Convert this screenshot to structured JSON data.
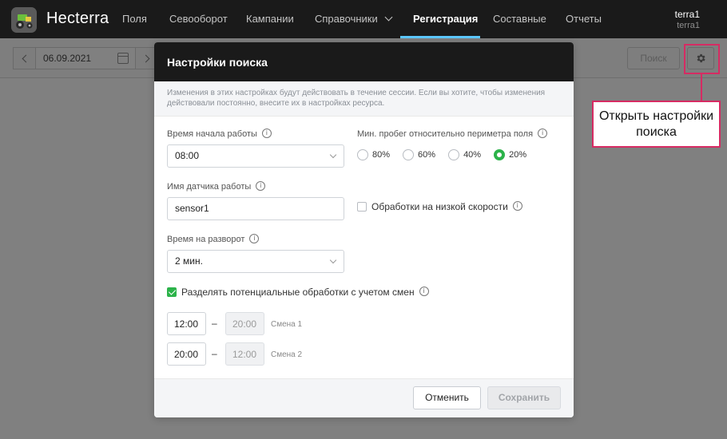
{
  "app": {
    "brand": "Hecterra",
    "logo_icon": "tractor-icon"
  },
  "nav": {
    "items": [
      {
        "label": "Поля"
      },
      {
        "label": "Севооборот"
      },
      {
        "label": "Кампании"
      },
      {
        "label": "Справочники"
      },
      {
        "label": "Регистрация"
      },
      {
        "label": "Составные"
      },
      {
        "label": "Отчеты"
      }
    ],
    "active": "Регистрация",
    "active_color": "#5cc8ff"
  },
  "user": {
    "name": "terra1",
    "account": "terra1"
  },
  "toolbar": {
    "date": "06.09.2021",
    "search_label": "Поиск"
  },
  "annotation": {
    "text": "Открыть настройки поиска",
    "color": "#d62b63"
  },
  "modal": {
    "title": "Настройки поиска",
    "note": "Изменения в этих настройках будут действовать в течение сессии. Если вы хотите, чтобы изменения действовали постоянно, внесите их в настройках ресурса.",
    "start_time": {
      "label": "Время начала работы",
      "value": "08:00"
    },
    "sensor": {
      "label": "Имя датчика работы",
      "value": "sensor1"
    },
    "turn_time": {
      "label": "Время на разворот",
      "value": "2 мин."
    },
    "mileage": {
      "label": "Мин. пробег относительно периметра поля",
      "options": [
        "80%",
        "60%",
        "40%",
        "20%"
      ],
      "selected": "20%"
    },
    "low_speed": {
      "label": "Обработки на низкой скорости",
      "checked": false
    },
    "split_shifts": {
      "label": "Разделять потенциальные обработки с учетом смен",
      "checked": true
    },
    "shifts": [
      {
        "start": "12:00",
        "end": "20:00",
        "label": "Смена 1"
      },
      {
        "start": "20:00",
        "end": "12:00",
        "label": "Смена 2"
      }
    ],
    "dash": "–",
    "info_glyph": "i",
    "cancel_label": "Отменить",
    "save_label": "Сохранить",
    "accent_color": "#2cb34a"
  }
}
